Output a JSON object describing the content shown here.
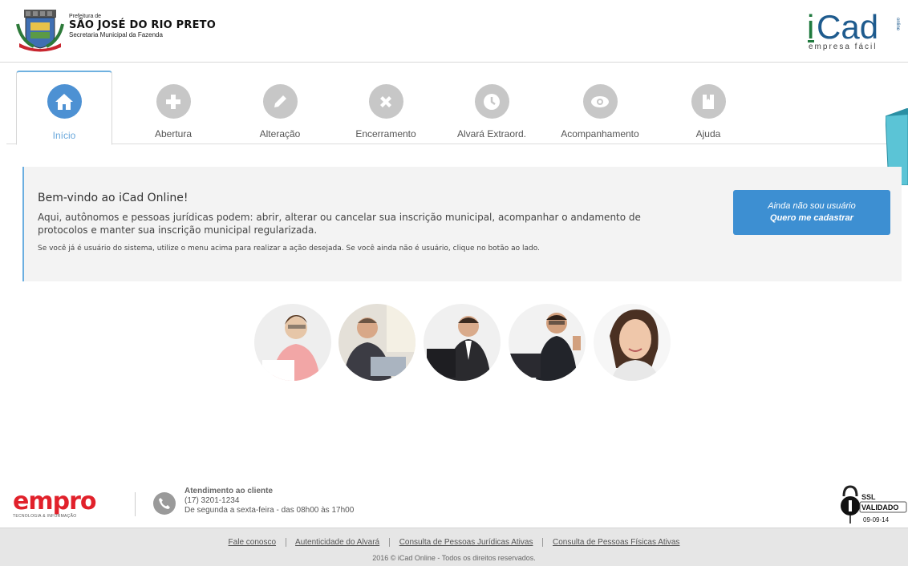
{
  "header": {
    "pref_small": "Prefeitura de",
    "city": "SÃO JOSÉ DO RIO PRETO",
    "secretaria": "Secretaria Municipal da Fazenda",
    "logo_main": "iCad",
    "logo_sub": "empresa fácil",
    "logo_vertical": "online"
  },
  "tabs": [
    {
      "label": "Início",
      "icon": "home-icon",
      "active": true
    },
    {
      "label": "Abertura",
      "icon": "plus-icon",
      "active": false
    },
    {
      "label": "Alteração",
      "icon": "pencil-icon",
      "active": false
    },
    {
      "label": "Encerramento",
      "icon": "close-icon",
      "active": false
    },
    {
      "label": "Alvará Extraord.",
      "icon": "clock-icon",
      "active": false
    },
    {
      "label": "Acompanhamento",
      "icon": "eye-icon",
      "active": false
    },
    {
      "label": "Ajuda",
      "icon": "book-icon",
      "active": false
    }
  ],
  "welcome": {
    "title": "Bem-vindo ao iCad Online!",
    "description": "Aqui, autônomos e pessoas jurídicas podem: abrir, alterar ou cancelar sua inscrição municipal, acompanhar o andamento de protocolos e manter sua inscrição municipal regularizada.",
    "note": "Se você já é usuário do sistema, utilize o menu acima para realizar a ação desejada. Se você ainda não é usuário, clique no botão ao lado.",
    "cta_line1": "Ainda não sou usuário",
    "cta_line2": "Quero me cadastrar"
  },
  "footer": {
    "empro_word": "empro",
    "empro_sub": "TECNOLOGIA & INFORMAÇÃO",
    "contact_title": "Atendimento ao cliente",
    "contact_phone": "(17) 3201-1234",
    "contact_hours": "De segunda a sexta-feira - das 08h00 às 17h00",
    "ssl_label": "SSL",
    "ssl_status": "VALIDADO",
    "ssl_date": "09-09-14",
    "links": [
      "Fale conosco",
      "Autenticidade do Alvará",
      "Consulta de Pessoas Jurídicas Ativas",
      "Consulta de Pessoas Físicas Ativas"
    ],
    "copyright": "2016 © iCad Online - Todos os direitos reservados."
  },
  "colors": {
    "accent": "#3d8fd2",
    "tab_icon_inactive": "#c7c7c7",
    "tab_icon_active": "#4d91d3",
    "brand_red": "#e1212b",
    "teal": "#5bc4d6"
  }
}
